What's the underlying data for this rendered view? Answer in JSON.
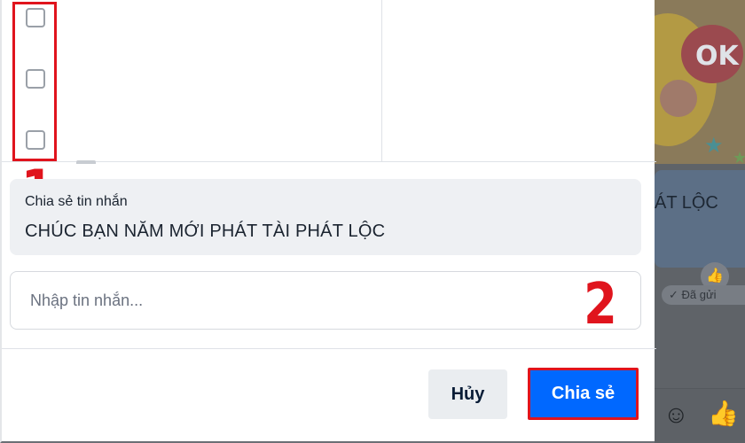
{
  "background_chat": {
    "sticker_text": "OK",
    "bubble_text": "ÁT LỘC",
    "sent_status": "✓ Đã gửi",
    "like_icon": "thumbs-up-icon",
    "emoji_icon": "smiley-icon"
  },
  "dialog": {
    "share_section": {
      "title": "Chia sẻ tin nhắn",
      "message": "CHÚC BẠN NĂM MỚI PHÁT TÀI PHÁT LỘC"
    },
    "message_input": {
      "value": "",
      "placeholder": "Nhập tin nhắn..."
    },
    "buttons": {
      "cancel_label": "Hủy",
      "share_label": "Chia sẻ"
    }
  },
  "annotations": {
    "step_1": "1",
    "step_2": "2",
    "color": "#e0141d"
  },
  "colors": {
    "primary": "#0068ff",
    "annotation": "#e0141d"
  }
}
